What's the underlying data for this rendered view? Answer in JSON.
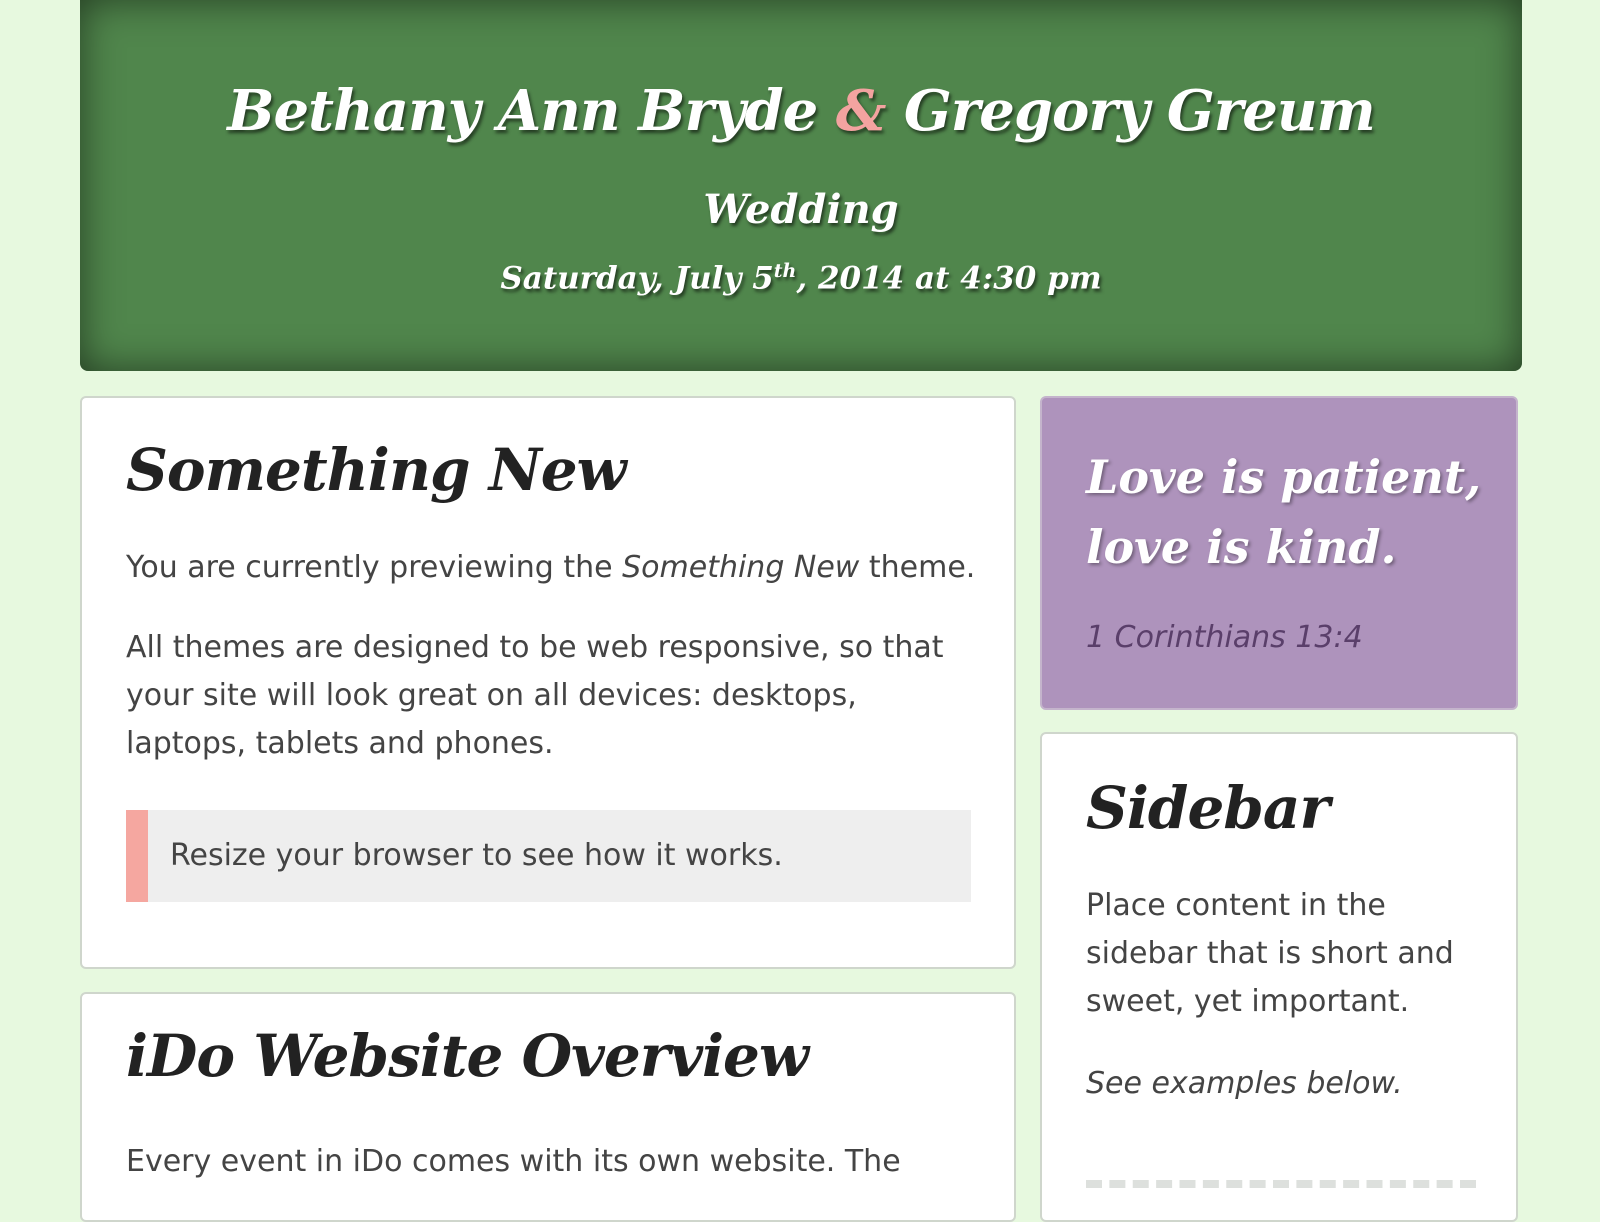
{
  "header": {
    "bride": "Bethany Ann Bryde",
    "ampersand": "&",
    "groom": "Gregory Greum",
    "event": "Wedding",
    "date_prefix": "Saturday, July 5",
    "date_suffix": "th",
    "date_rest": ", 2014 at 4:30 pm"
  },
  "cards": {
    "something_new": {
      "title": "Something New",
      "p1_before": "You are currently previewing the ",
      "p1_em": "Something New",
      "p1_after": " theme.",
      "p2": "All themes are designed to be web responsive, so that your site will look great on all devices: desktops, laptops, tablets and phones.",
      "callout": "Resize your browser to see how it works."
    },
    "overview": {
      "title": "iDo Website Overview",
      "p1": "Every event in iDo comes with its own website. The"
    }
  },
  "sidebar": {
    "quote": {
      "line1": "Love is patient,",
      "line2": "love is kind.",
      "reference": "1 Corinthians 13:4"
    },
    "widget": {
      "title": "Sidebar",
      "text": "Place content in the sidebar that is short and sweet, yet important.",
      "note": "See examples below."
    }
  },
  "colors": {
    "background": "#e7f9df",
    "header_green": "#50864c",
    "accent_pink": "#f3a3a0",
    "quote_purple": "#ae93bc"
  }
}
